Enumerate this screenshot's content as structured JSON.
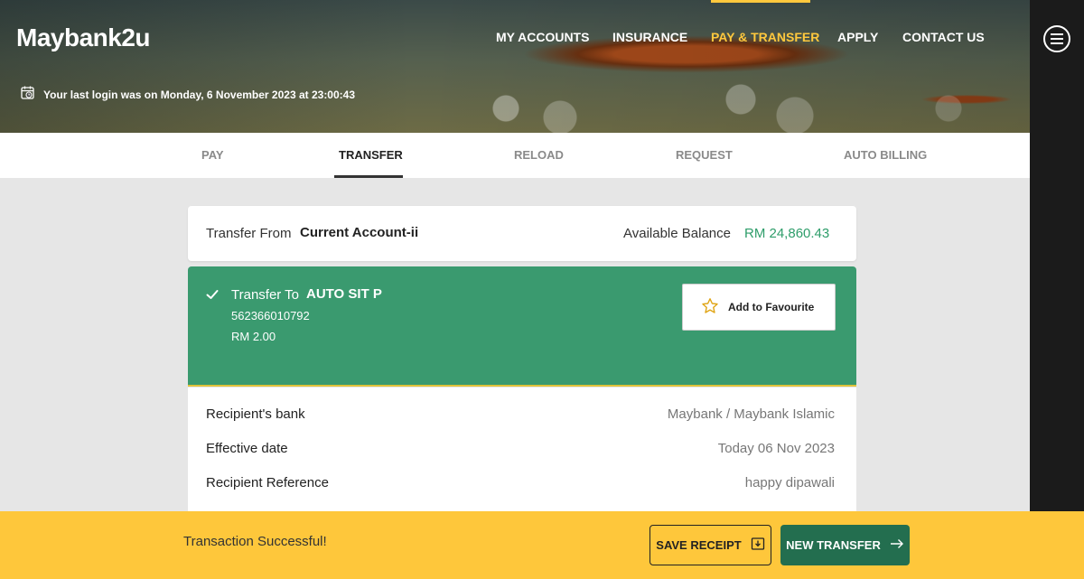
{
  "header": {
    "logo": "Maybank2u",
    "nav": [
      {
        "label": "MY ACCOUNTS"
      },
      {
        "label": "INSURANCE"
      },
      {
        "label": "PAY & TRANSFER"
      },
      {
        "label": "APPLY"
      },
      {
        "label": "CONTACT US"
      }
    ],
    "login_info": "Your last login was on Monday, 6 November 2023 at 23:00:43",
    "accent_color": "#ffc83d"
  },
  "subnav": {
    "tabs": [
      {
        "label": "PAY"
      },
      {
        "label": "TRANSFER"
      },
      {
        "label": "RELOAD"
      },
      {
        "label": "REQUEST"
      },
      {
        "label": "AUTO BILLING"
      }
    ],
    "selected": "TRANSFER"
  },
  "transfer_from": {
    "label": "Transfer From",
    "account": "Current Account-ii",
    "balance_label": "Available Balance",
    "balance": "RM 24,860.43"
  },
  "transfer_to": {
    "label": "Transfer To",
    "name": "AUTO SIT P",
    "account_number": "562366010792",
    "amount": "RM 2.00",
    "favourite_label": "Add to Favourite",
    "color": "#3a9a6f"
  },
  "details": [
    {
      "key": "Recipient's bank",
      "value": "Maybank / Maybank Islamic"
    },
    {
      "key": "Effective date",
      "value": "Today 06 Nov 2023"
    },
    {
      "key": "Recipient Reference",
      "value": "happy dipawali"
    }
  ],
  "footer": {
    "status": "Transaction Successful!",
    "save_receipt": "SAVE RECEIPT",
    "new_transfer": "NEW TRANSFER",
    "bar_color": "#fec73b"
  }
}
